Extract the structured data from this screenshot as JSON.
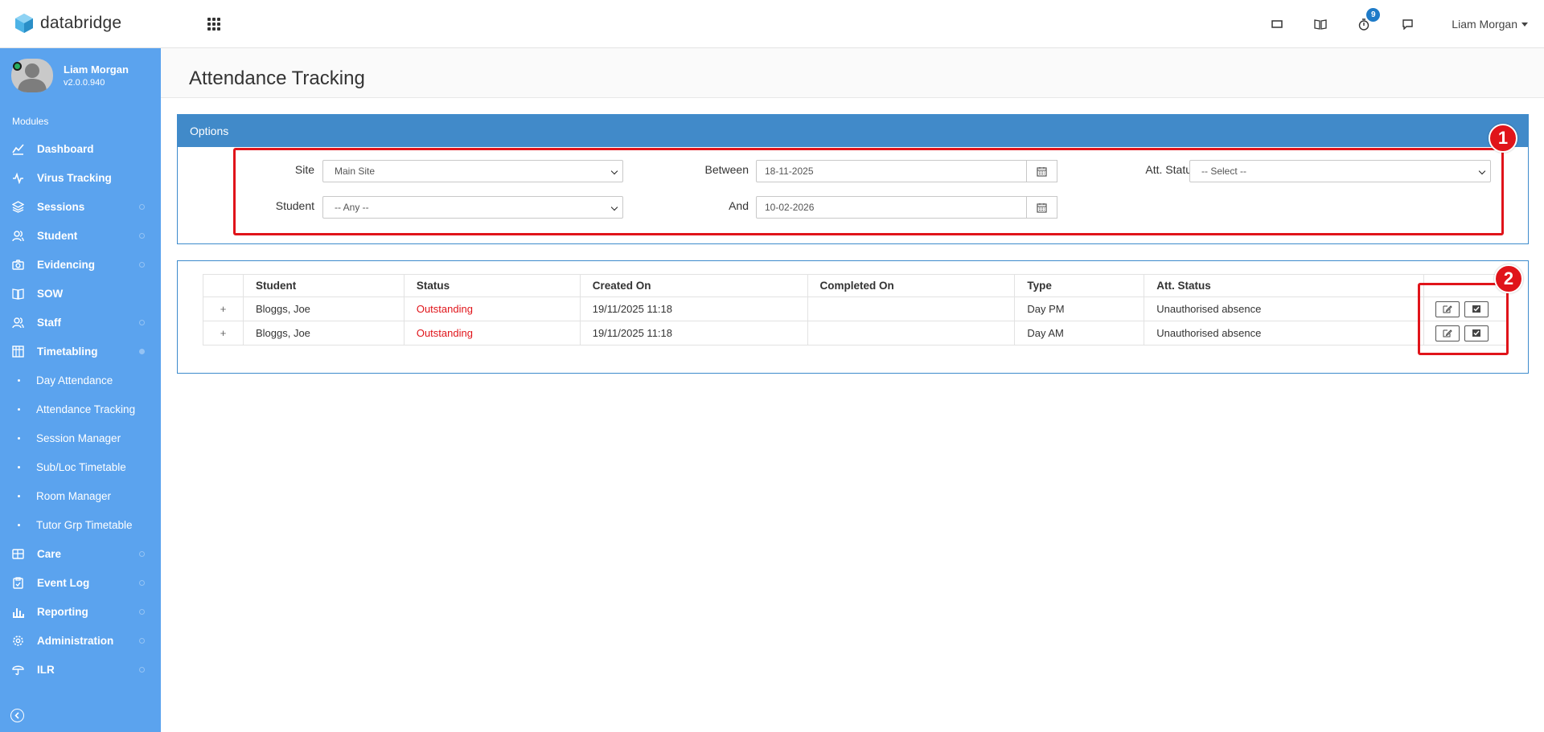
{
  "app": {
    "name": "databridge"
  },
  "topbar": {
    "notification_count": "9",
    "user_name": "Liam Morgan"
  },
  "sidebar": {
    "profile": {
      "name": "Liam Morgan",
      "version": "v2.0.0.940"
    },
    "modules_label": "Modules",
    "items": [
      {
        "label": "Dashboard",
        "icon": "chart-line-icon"
      },
      {
        "label": "Virus Tracking",
        "icon": "pulse-icon"
      },
      {
        "label": "Sessions",
        "icon": "layers-icon"
      },
      {
        "label": "Student",
        "icon": "users-icon"
      },
      {
        "label": "Evidencing",
        "icon": "camera-icon"
      },
      {
        "label": "SOW",
        "icon": "book-icon"
      },
      {
        "label": "Staff",
        "icon": "users-icon"
      },
      {
        "label": "Timetabling",
        "icon": "calendar-grid-icon"
      }
    ],
    "sub_items": [
      {
        "label": "Day Attendance"
      },
      {
        "label": "Attendance Tracking"
      },
      {
        "label": "Session Manager"
      },
      {
        "label": "Sub/Loc Timetable"
      },
      {
        "label": "Room Manager"
      },
      {
        "label": "Tutor Grp Timetable"
      }
    ],
    "items_after": [
      {
        "label": "Care",
        "icon": "table-icon"
      },
      {
        "label": "Event Log",
        "icon": "clipboard-icon"
      },
      {
        "label": "Reporting",
        "icon": "bar-chart-icon"
      },
      {
        "label": "Administration",
        "icon": "gear-icon"
      },
      {
        "label": "ILR",
        "icon": "umbrella-icon"
      }
    ]
  },
  "page": {
    "title": "Attendance Tracking"
  },
  "options": {
    "heading": "Options",
    "site_label": "Site",
    "site_value": "Main Site",
    "student_label": "Student",
    "student_value": "-- Any --",
    "between_label": "Between",
    "between_value": "18-11-2025",
    "and_label": "And",
    "and_value": "10-02-2026",
    "att_status_label": "Att. Status",
    "att_status_value": "-- Select --"
  },
  "table": {
    "columns": [
      "Student",
      "Status",
      "Created On",
      "Completed On",
      "Type",
      "Att. Status"
    ],
    "rows": [
      {
        "expand": "+",
        "student": "Bloggs, Joe",
        "status": "Outstanding",
        "created_on": "19/11/2025 11:18",
        "completed_on": "",
        "type": "Day PM",
        "att_status": "Unauthorised absence"
      },
      {
        "expand": "+",
        "student": "Bloggs, Joe",
        "status": "Outstanding",
        "created_on": "19/11/2025 11:18",
        "completed_on": "",
        "type": "Day AM",
        "att_status": "Unauthorised absence"
      }
    ]
  },
  "callouts": {
    "first": "1",
    "second": "2"
  },
  "colors": {
    "sidebar": "#5ba3ee",
    "panel_header": "#418ac9",
    "status_outstanding": "#e0141a",
    "callout": "#e0141a"
  }
}
